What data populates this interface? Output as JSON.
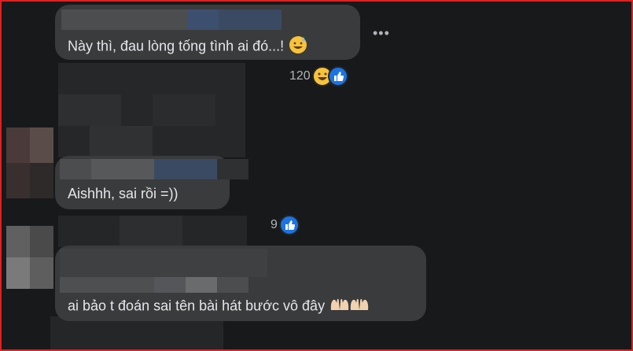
{
  "comments": [
    {
      "text": "Này thì, đau lòng tống tình ai đó...!",
      "emoji": "sweat-smile-emoji",
      "reaction_count": "120",
      "reactions": [
        "haha-icon",
        "like-icon"
      ]
    },
    {
      "text": "Aishhh, sai rồi =))",
      "reaction_count": "9",
      "reactions": [
        "like-icon"
      ]
    },
    {
      "text": "ai bảo t đoán sai tên bài hát bước vô đây",
      "emoji": "raising-hands-emoji"
    }
  ],
  "more_options_label": "•••",
  "colors": {
    "bubble": "#3a3b3c",
    "background": "#18191a",
    "text": "#e4e6eb",
    "like": "#1b74e4",
    "haha": "#f7c33a",
    "border": "#e02020"
  }
}
